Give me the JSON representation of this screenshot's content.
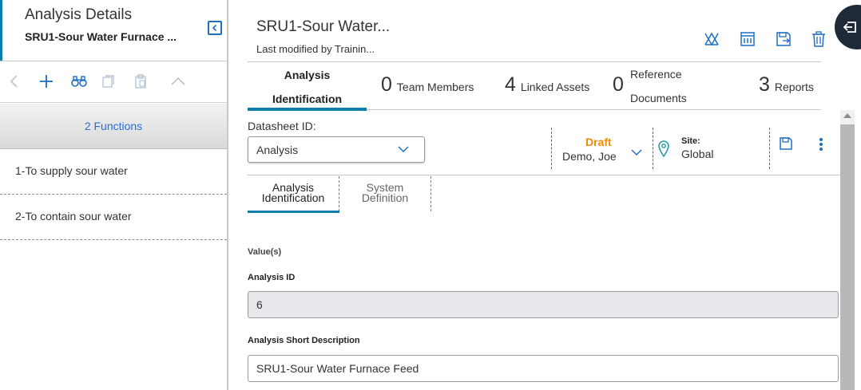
{
  "left_panel": {
    "title": "Analysis Details",
    "subtitle": "SRU1-Sour Water Furnace ...",
    "functions_header": "2 Functions",
    "functions": [
      {
        "label": "1-To supply sour water"
      },
      {
        "label": "2-To contain sour water"
      }
    ],
    "toolbar_icons": [
      "back-icon",
      "add-icon",
      "binoculars-icon",
      "copy-icon",
      "paste-icon",
      "collapse-up-icon"
    ]
  },
  "header": {
    "title": "SRU1-Sour Water...",
    "subtitle": "Last modified by Trainin...",
    "icons": [
      "network-icon",
      "report-icon",
      "save-icon",
      "delete-icon"
    ]
  },
  "stats_tabs": {
    "active_tab": {
      "line1": "Analysis",
      "line2": "Identification"
    },
    "team_members": {
      "count": "0",
      "label": "Team Members"
    },
    "linked_assets": {
      "count": "4",
      "label": "Linked Assets"
    },
    "reference_documents": {
      "count": "0",
      "line1": "Reference",
      "line2": "Documents"
    },
    "reports": {
      "count": "3",
      "label": "Reports"
    }
  },
  "datasheet": {
    "label": "Datasheet ID:",
    "selected": "Analysis",
    "state": "Draft",
    "owner": "Demo, Joe",
    "site_label": "Site:",
    "site_value": "Global"
  },
  "subtabs": {
    "active": {
      "line1": "Analysis",
      "line2": "Identification"
    },
    "inactive": {
      "line1": "System",
      "line2": "Definition"
    }
  },
  "form": {
    "values_label": "Value(s)",
    "analysis_id_label": "Analysis ID",
    "analysis_id_value": "6",
    "short_desc_label": "Analysis Short Description",
    "short_desc_value": "SRU1-Sour Water Furnace Feed"
  },
  "colors": {
    "accent": "#0f7ea8",
    "link_blue": "#2a6fd1",
    "draft_orange": "#f08a00",
    "icon_blue": "#1f6fc1",
    "readonly_bg": "#e6e8ec"
  }
}
